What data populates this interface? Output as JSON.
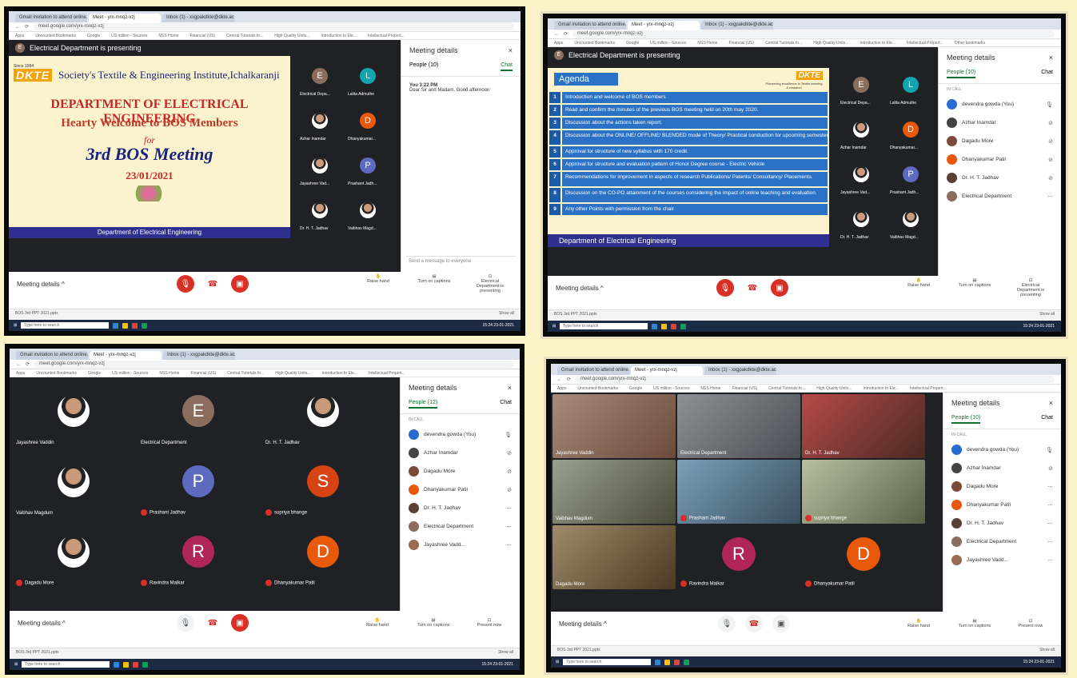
{
  "browser": {
    "tabs": [
      "Gmail invitation to attend online...",
      "Meet - yrx-mnqz-vzj",
      "Inbox (1) - xxgpakdkte@dkte.ac.in"
    ],
    "url": "meet.google.com/yrx-mnqz-vzj",
    "bookmarks": [
      "Apps",
      "Uncounted Bookmarks",
      "Google",
      "US million - Sources",
      "NSS Home",
      "Financial (US)",
      "Central Tutorials fo...",
      "High Quality Units...",
      "Introduction to Ele...",
      "Intellectual Propert...",
      "Other bookmarks"
    ]
  },
  "presenting_text": "Electrical Department is presenting",
  "presenter_initial": "E",
  "meeting_details_label": "Meeting details",
  "meeting_details_chevron": "^",
  "side_panel": {
    "title": "Meeting details",
    "close": "×",
    "people_tab": "People (10)",
    "people_tab_q3": "People (12)",
    "chat_tab": "Chat",
    "in_call": "IN CALL",
    "chat_msg_who": "You  3:22 PM",
    "chat_msg_text": "Dear Sir and Madam, Good afternoon",
    "chat_input": "Send a message to everyone",
    "participants": [
      {
        "name": "devendra gowda (You)",
        "color": "#2a6bd1"
      },
      {
        "name": "Azhar Inamdar",
        "color": "#444444"
      },
      {
        "name": "Dagadu More",
        "color": "#7a4a3a"
      },
      {
        "name": "Dhanyakumar Patil",
        "color": "#e8590c"
      },
      {
        "name": "Dr. H. T. Jadhav",
        "color": "#5a3f34"
      },
      {
        "name": "Electrical Department",
        "color": "#8a6d5c"
      },
      {
        "name": "Jayashree Vadd...",
        "color": "#9b6b4f"
      }
    ]
  },
  "controls": {
    "raise_hand": "Raise hand",
    "captions": "Turn on captions",
    "presenting": "Electrical Department is presenting",
    "present_now": "Present now"
  },
  "download": "BOS 3rd PPT 2021.pptx",
  "show_all": "Show all",
  "taskbar": {
    "search": "Type here to search",
    "time": "15:24",
    "date": "23-01-2021"
  },
  "slide1": {
    "estd": "Since 1984",
    "logo": "DKTE",
    "institute": "Society's Textile & Engineering Institute,Ichalkaranji",
    "dept": "DEPARTMENT OF ELECTRICAL ENGINEERING",
    "welcome": "Hearty Welcome to BOS Members",
    "for": "for",
    "meeting": "3rd BOS Meeting",
    "date": "23/01/2021",
    "footer": "Department of Electrical Engineering"
  },
  "slide2": {
    "title": "Agenda",
    "logo": "DKTE",
    "tagline": "Pioneering excellence in Textile learning & research",
    "footer": "Department of Electrical Engineering",
    "items": [
      {
        "n": "1",
        "t": "Introduction and welcome of BOS members"
      },
      {
        "n": "2",
        "t": "Read and confirm the minutes of the previous BOS meeting held on 20th may 2020."
      },
      {
        "n": "3",
        "t": "Discussion about the actions taken report."
      },
      {
        "n": "4",
        "t": "Discussion about the ONLINE/ OFFLINE/ BLENDED mode of Theory/ Practical conduction for upcoming semester."
      },
      {
        "n": "5",
        "t": "Approval for structure of new syllabus with 170 credit."
      },
      {
        "n": "6",
        "t": "Approval for structure and evaluation pattern of Honor Degree course - Electric Vehicle"
      },
      {
        "n": "7",
        "t": "Recommendations for improvement in aspects of research Publications/ Patents/ Consultancy/ Placements."
      },
      {
        "n": "8",
        "t": "Discussion on the CO-PO attainment of the courses considering the impact of online teaching and evaluation."
      },
      {
        "n": "9",
        "t": "Any other Points with permission from the chair"
      }
    ]
  },
  "q1_tiles": [
    {
      "name": "Electrical Depa...",
      "init": "E",
      "color": "#8a6d5c"
    },
    {
      "name": "Lalita Admuthe",
      "init": "L",
      "color": "#12a4af"
    },
    {
      "name": "Azhar Inamdar",
      "init": "",
      "color": "#666666"
    },
    {
      "name": "Dhanyakumar...",
      "init": "D",
      "color": "#e8590c"
    },
    {
      "name": "Jayashree Vad...",
      "init": "",
      "color": "#9b6b4f"
    },
    {
      "name": "Prashant Jadh...",
      "init": "P",
      "color": "#5c6bc0"
    },
    {
      "name": "Dr. H. T. Jadhav",
      "init": "",
      "color": "#5a3f34"
    },
    {
      "name": "Vaibhav Magd...",
      "init": "",
      "color": "#3d5a80"
    }
  ],
  "q3_tiles": [
    {
      "name": "Jayashree Vaddin",
      "init": "",
      "color": "#9b6b4f"
    },
    {
      "name": "Electrical Department",
      "init": "E",
      "color": "#8a6d5c"
    },
    {
      "name": "Dr. H. T. Jadhav",
      "init": "",
      "color": "#5a3f34"
    },
    {
      "name": "Vaibhav Magdum",
      "init": "",
      "color": "#3d5a80"
    },
    {
      "name": "Prashant Jadhav",
      "init": "P",
      "color": "#5c6bc0"
    },
    {
      "name": "supriya bhange",
      "init": "S",
      "color": "#d84315"
    },
    {
      "name": "Dagadu More",
      "init": "",
      "color": "#7a4a3a"
    },
    {
      "name": "Ravindra Malkar",
      "init": "R",
      "color": "#b0265a"
    },
    {
      "name": "Dhanyakumar Patil",
      "init": "D",
      "color": "#e8590c"
    }
  ],
  "q4_tiles": [
    {
      "name": "Jayashree Vaddin",
      "init": "",
      "color": "#7d5a48"
    },
    {
      "name": "Electrical Department",
      "init": "",
      "color": "#5a5f66"
    },
    {
      "name": "Dr. H. T. Jadhav",
      "init": "",
      "color": "#6b3b2e"
    },
    {
      "name": "Vaibhav Magdum",
      "init": "",
      "color": "#6b6f66"
    },
    {
      "name": "Prashant Jadhav",
      "init": "",
      "color": "#3b5f7a"
    },
    {
      "name": "supriya bhange",
      "init": "",
      "color": "#7a8a6b"
    },
    {
      "name": "Dagadu More",
      "init": "",
      "color": "#6b5a3b"
    },
    {
      "name": "Ravindra Malkar",
      "init": "R",
      "color": "#b0265a"
    },
    {
      "name": "Dhanyakumar Patil",
      "init": "D",
      "color": "#e8590c"
    }
  ]
}
